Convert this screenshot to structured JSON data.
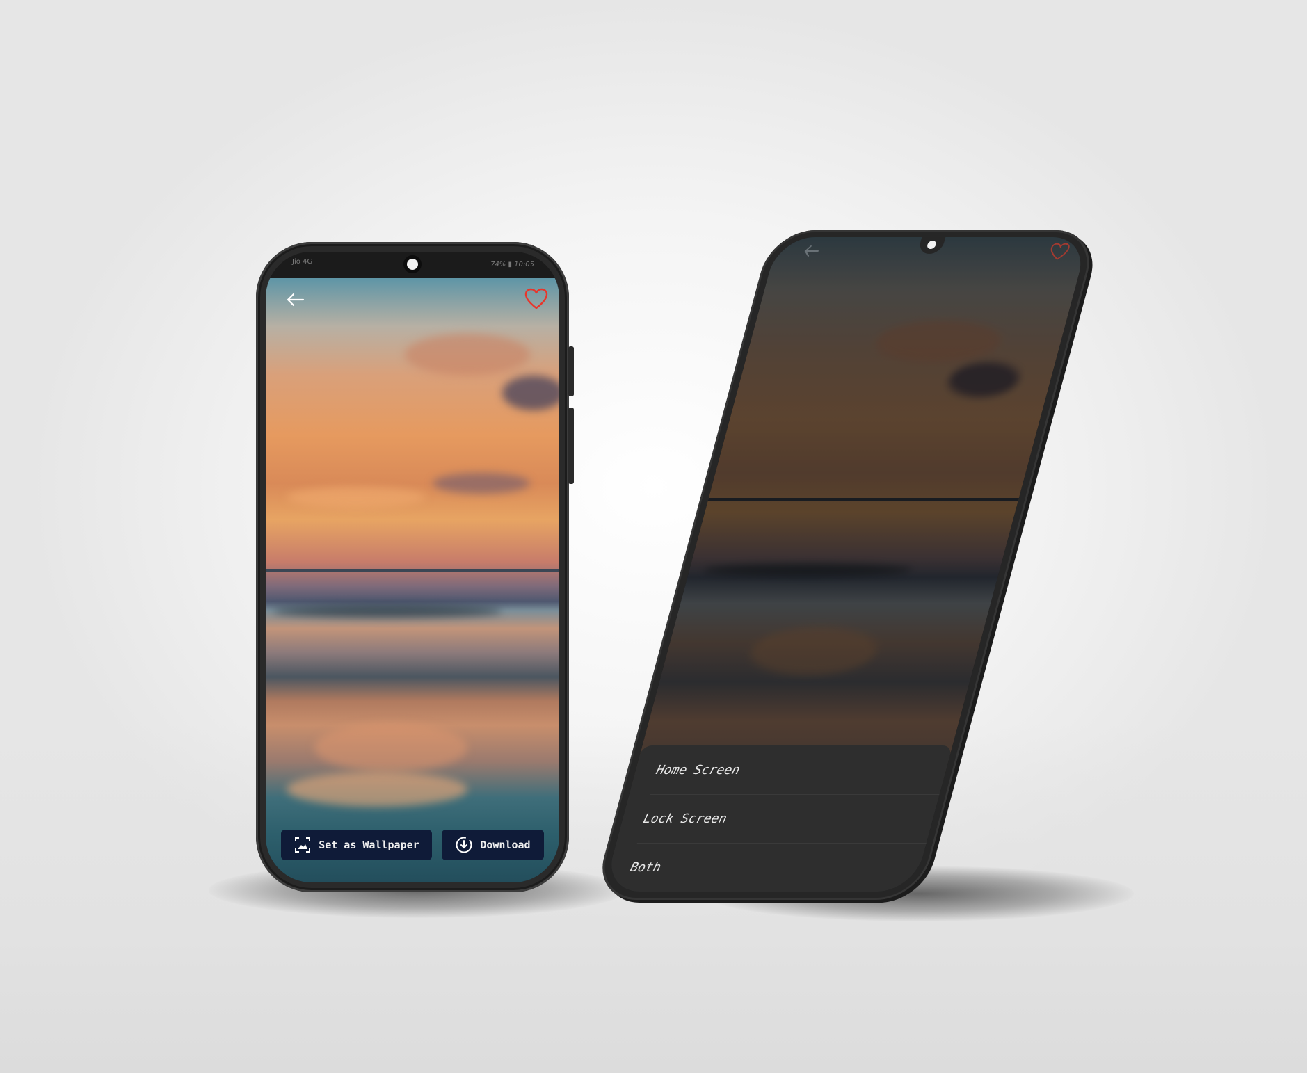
{
  "phone_left": {
    "status_bar": {
      "carrier": "Jio 4G",
      "battery": "74%",
      "time": "10:05"
    },
    "back_icon": "arrow-left-icon",
    "favorite_icon": "heart-icon",
    "actions": {
      "set_wallpaper_label": "Set as Wallpaper",
      "download_label": "Download"
    },
    "colors": {
      "button_bg": "#0f1b38",
      "heart": "#e8352b"
    }
  },
  "phone_right": {
    "sheet_options": [
      {
        "label": "Home Screen"
      },
      {
        "label": "Lock Screen"
      },
      {
        "label": "Both"
      }
    ],
    "colors": {
      "sheet_bg": "#2e2e2e"
    }
  }
}
